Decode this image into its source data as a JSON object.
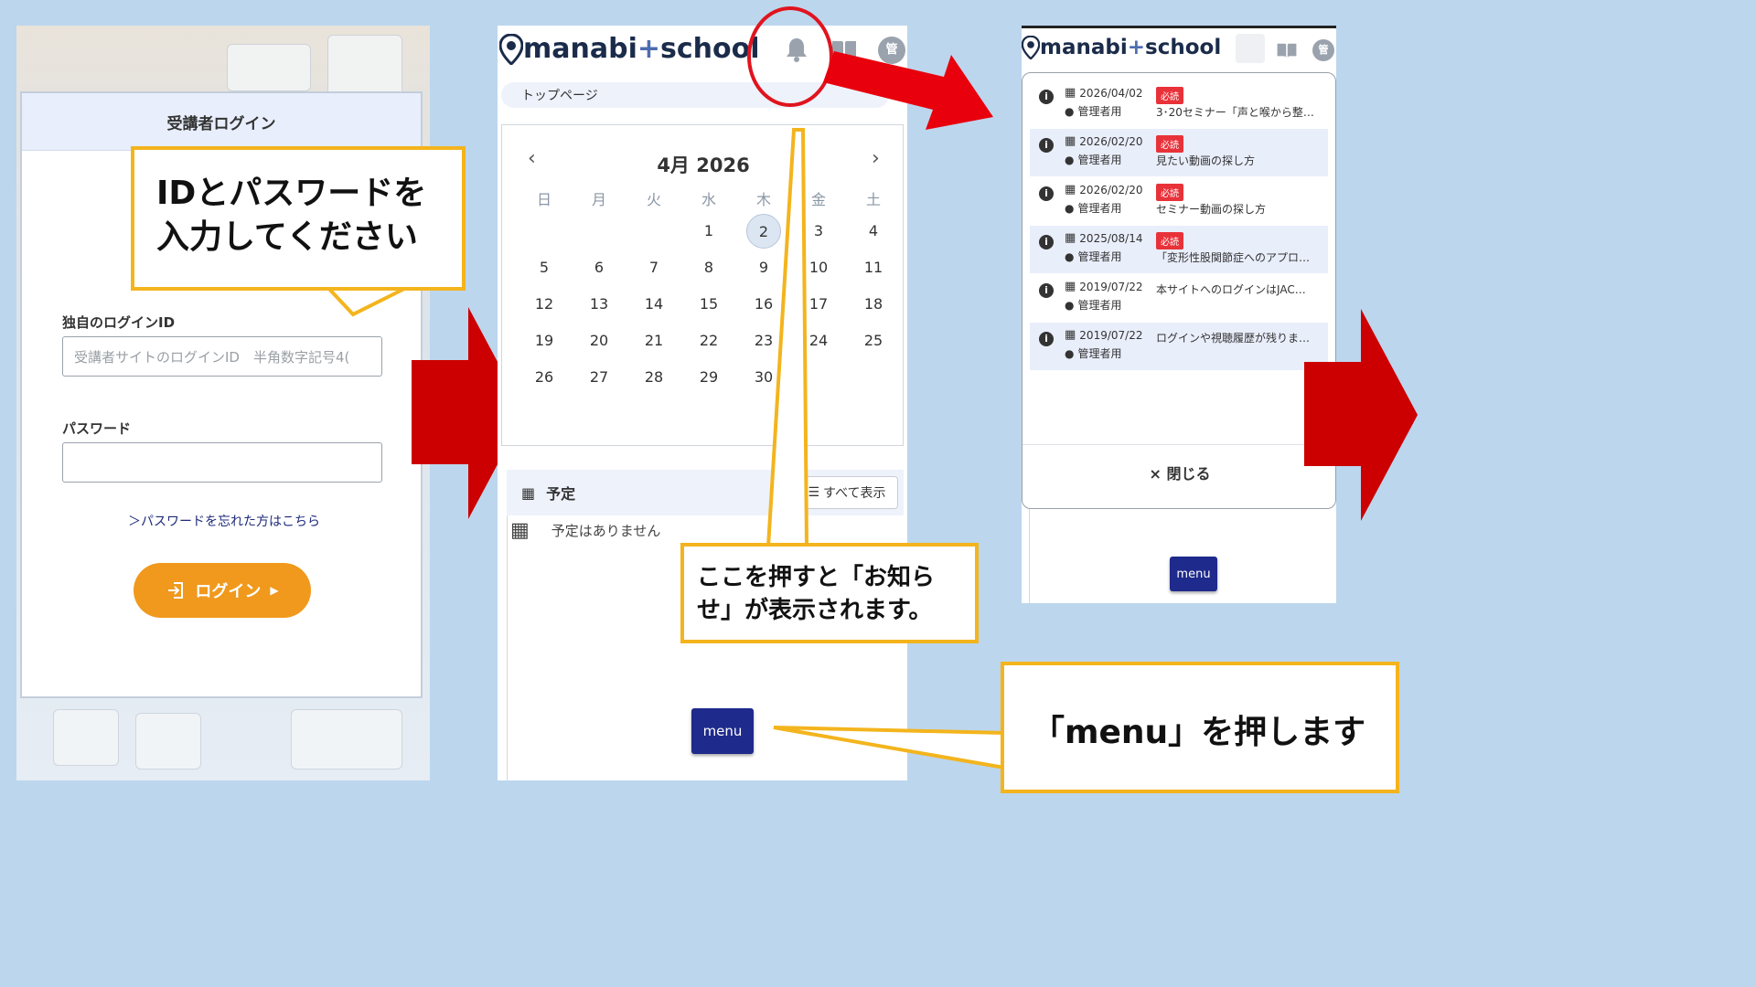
{
  "login": {
    "header": "受講者ログイン",
    "id_label": "独自のログインID",
    "id_placeholder": "受講者サイトのログインID　半角数字記号4(",
    "password_label": "パスワード",
    "password_value": "",
    "forgot_link": "＞パスワードを忘れた方はこちら",
    "login_button": "ログイン"
  },
  "callout_login": {
    "line1": "IDとパスワードを",
    "line2": "入力してください"
  },
  "top_page": {
    "logo_main": "manabi",
    "logo_plus": "+",
    "logo_school": "school",
    "admin_badge": "管",
    "breadcrumb": "トップページ",
    "calendar": {
      "title": "4月 2026",
      "weekdays": [
        "日",
        "月",
        "火",
        "水",
        "木",
        "金",
        "土"
      ],
      "weeks": [
        [
          "",
          "",
          "",
          "1",
          "2",
          "3",
          "4"
        ],
        [
          "5",
          "6",
          "7",
          "8",
          "9",
          "10",
          "11"
        ],
        [
          "12",
          "13",
          "14",
          "15",
          "16",
          "17",
          "18"
        ],
        [
          "19",
          "20",
          "21",
          "22",
          "23",
          "24",
          "25"
        ],
        [
          "26",
          "27",
          "28",
          "29",
          "30",
          "",
          ""
        ]
      ],
      "today": "2"
    },
    "schedule_title": "予定",
    "show_all": "すべて表示",
    "no_schedule": "予定はありません",
    "menu_button": "menu"
  },
  "callout_bell": {
    "line1": "ここを押すと「お知ら",
    "line2": "せ」が表示されます。"
  },
  "notices_page": {
    "logo_main": "manabi",
    "logo_plus": "+",
    "logo_school": "school",
    "admin_badge": "管",
    "notices": [
      {
        "date": "2026/04/02",
        "author": "管理者用",
        "badge": "必読",
        "title": "3･20セミナー「声と喉から整…"
      },
      {
        "date": "2026/02/20",
        "author": "管理者用",
        "badge": "必読",
        "title": "見たい動画の探し方"
      },
      {
        "date": "2026/02/20",
        "author": "管理者用",
        "badge": "必読",
        "title": "セミナー動画の探し方"
      },
      {
        "date": "2025/08/14",
        "author": "管理者用",
        "badge": "必読",
        "title": "「変形性股関節症へのアプロ…"
      },
      {
        "date": "2019/07/22",
        "author": "管理者用",
        "badge": "",
        "title": "本サイトへのログインはJAC…"
      },
      {
        "date": "2019/07/22",
        "author": "管理者用",
        "badge": "",
        "title": "ログインや視聴履歴が残りま…"
      }
    ],
    "close_button": "× 閉じる",
    "menu_button": "menu"
  },
  "callout_menu": {
    "text": "「menu」を押します"
  },
  "colors": {
    "accent_orange": "#f0991c",
    "callout_border": "#f3b41d",
    "menu_navy": "#1e2a8c",
    "arrow_red": "#cc0000",
    "badge_red": "#e8323a"
  }
}
